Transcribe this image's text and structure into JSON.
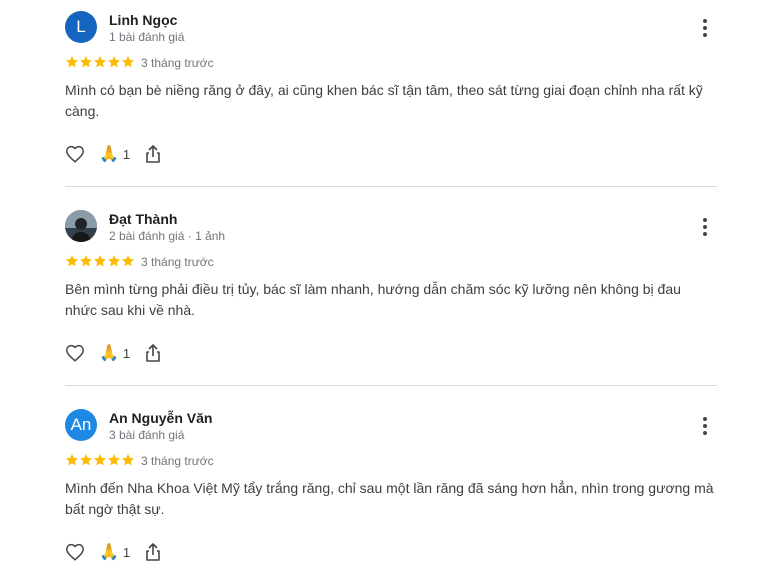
{
  "reviews": [
    {
      "name": "Linh Ngọc",
      "meta": "1 bài đánh giá",
      "avatar_letter": "L",
      "avatar_color": "#1565c0",
      "rating": 5,
      "time": "3 tháng trước",
      "text": "Mình có bạn bè niềng răng ở đây, ai cũng khen bác sĩ tận tâm, theo sát từng giai đoạn chỉnh nha rất kỹ càng.",
      "thanks": "1"
    },
    {
      "name": "Đạt Thành",
      "meta": "2 bài đánh giá · 1 ảnh",
      "avatar_letter": "",
      "avatar_color": "#5b6b7a",
      "rating": 5,
      "time": "3 tháng trước",
      "text": "Bên mình từng phải điều trị tủy, bác sĩ làm nhanh, hướng dẫn chăm sóc kỹ lưỡng nên không bị đau nhức sau khi về nhà.",
      "thanks": "1"
    },
    {
      "name": "An Nguyễn Văn",
      "meta": "3 bài đánh giá",
      "avatar_letter": "An",
      "avatar_color": "#1e88e5",
      "rating": 5,
      "time": "3 tháng trước",
      "text": "Mình đến Nha Khoa Việt Mỹ tẩy trắng răng, chỉ sau một lần răng đã sáng hơn hẳn, nhìn trong gương mà bất ngờ thật sự.",
      "thanks": "1"
    }
  ],
  "colors": {
    "star": "#fbbc04",
    "divider": "#dadce0",
    "icon": "#444746"
  }
}
